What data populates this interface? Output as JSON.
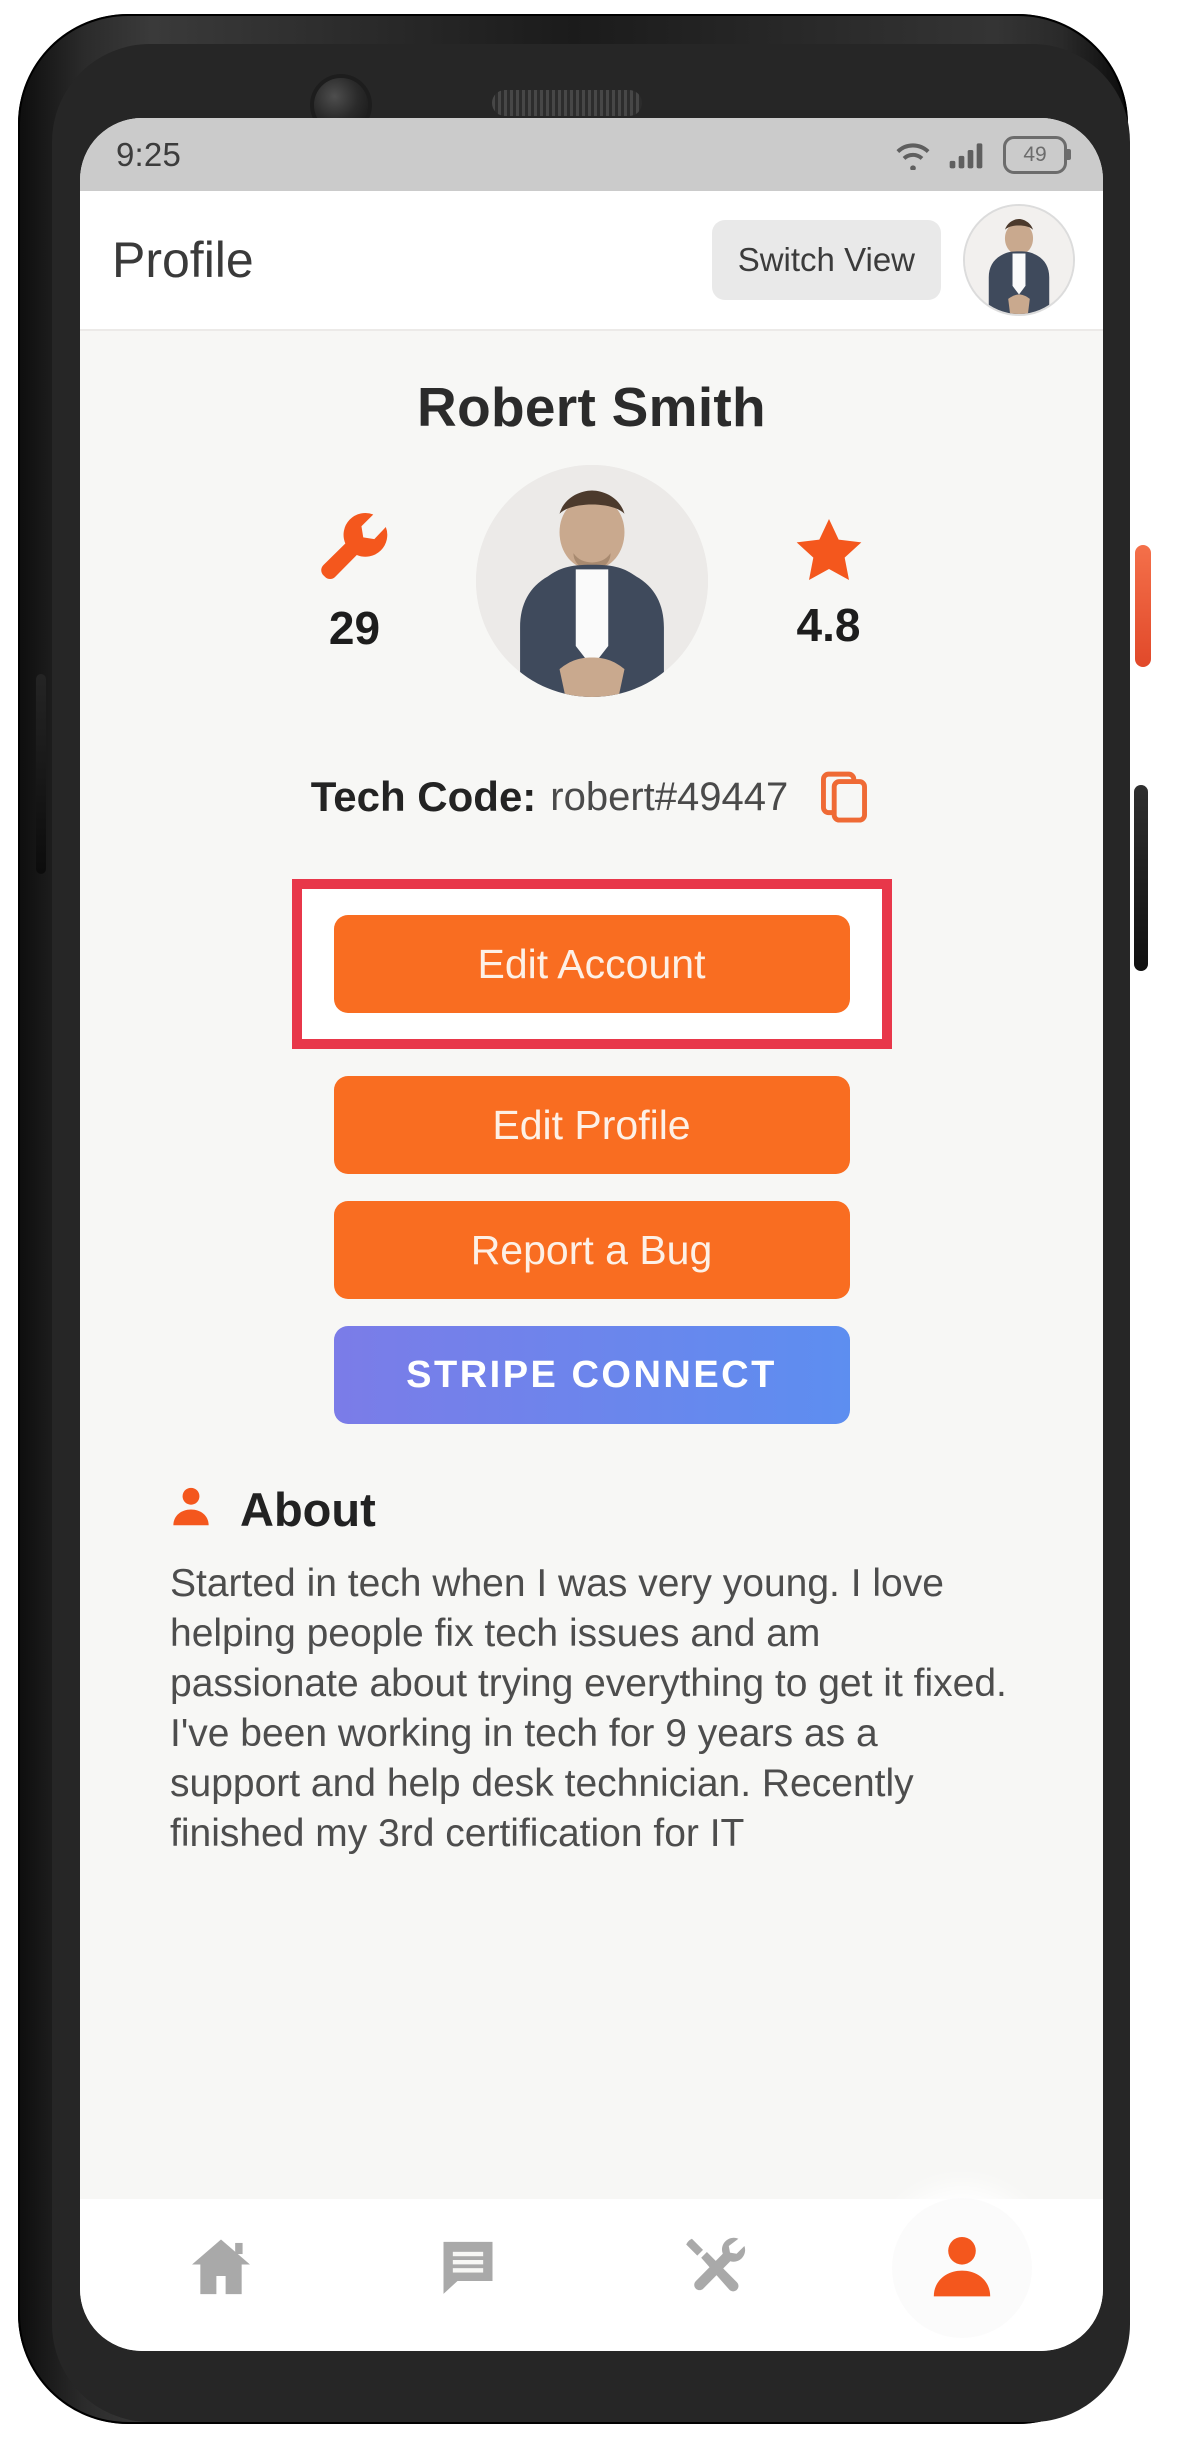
{
  "status_bar": {
    "time": "9:25",
    "wifi_icon": "wifi-icon",
    "cellular_icon": "cellular-signal-icon",
    "battery_level": "49"
  },
  "header": {
    "title": "Profile",
    "switch_view_label": "Switch View",
    "avatar_alt": "user-avatar"
  },
  "profile": {
    "name": "Robert Smith",
    "jobs_icon": "wrench-icon",
    "jobs_count": "29",
    "rating_icon": "star-icon",
    "rating_value": "4.8",
    "tech_code_label": "Tech Code:",
    "tech_code_value": "robert#49447",
    "copy_icon": "copy-icon"
  },
  "actions": {
    "edit_account": "Edit Account",
    "edit_profile": "Edit Profile",
    "report_bug": "Report a Bug",
    "stripe_connect": "STRIPE CONNECT"
  },
  "about": {
    "icon": "person-icon",
    "title": "About",
    "text": "Started in tech when I was very young. I love helping people fix tech issues and am passionate about trying everything to get it fixed. I've been working in tech for 9 years as a support and help desk technician. Recently finished my 3rd certification for IT"
  },
  "bottom_nav": [
    {
      "name": "home",
      "icon": "home-icon",
      "active": false
    },
    {
      "name": "messages",
      "icon": "chat-icon",
      "active": false
    },
    {
      "name": "jobs",
      "icon": "tools-icon",
      "active": false
    },
    {
      "name": "profile",
      "icon": "person-icon",
      "active": true
    }
  ],
  "colors": {
    "accent_orange": "#f96d21",
    "highlight_red": "#e8374a",
    "stripe_gradient_start": "#7b7ce8",
    "stripe_gradient_end": "#5d8ef0",
    "nav_inactive": "#a9a9a9"
  }
}
